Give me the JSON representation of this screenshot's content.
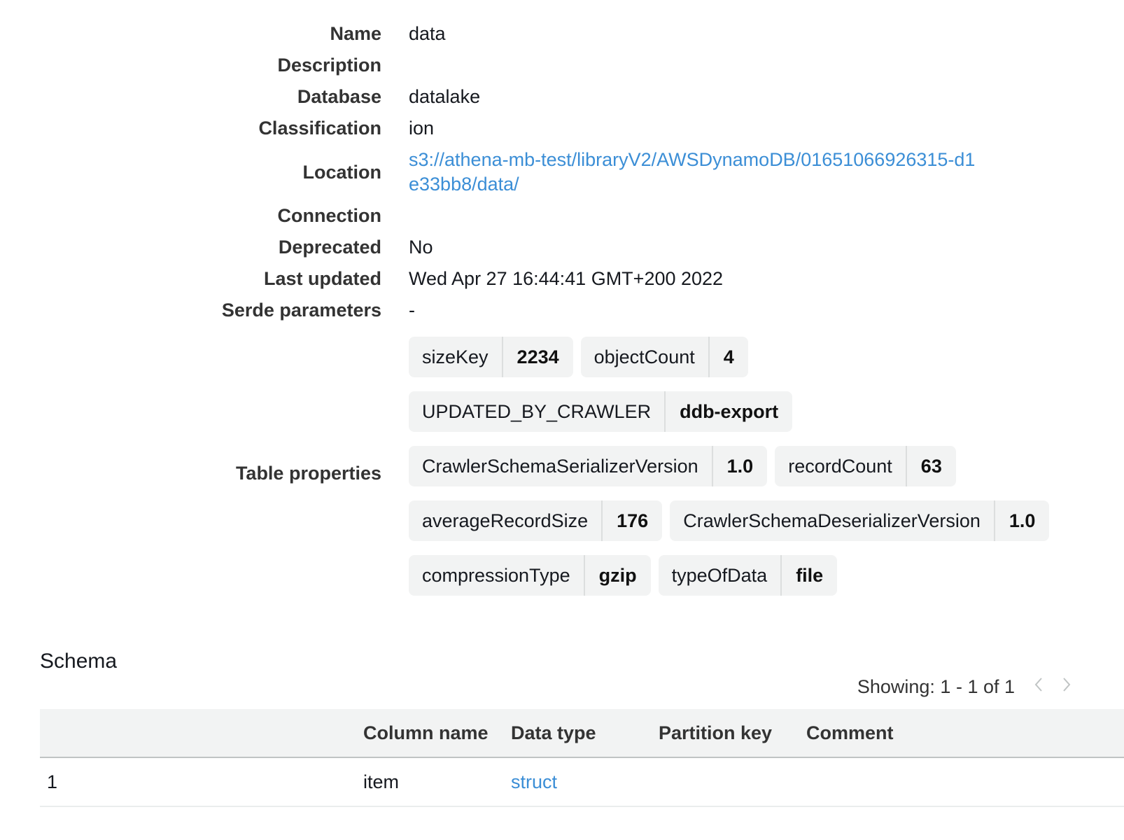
{
  "details": {
    "name": {
      "label": "Name",
      "value": "data"
    },
    "description": {
      "label": "Description",
      "value": ""
    },
    "database": {
      "label": "Database",
      "value": "datalake"
    },
    "classification": {
      "label": "Classification",
      "value": "ion"
    },
    "location": {
      "label": "Location",
      "value": "s3://athena-mb-test/libraryV2/AWSDynamoDB/01651066926315-d1e33bb8/data/"
    },
    "connection": {
      "label": "Connection",
      "value": ""
    },
    "deprecated": {
      "label": "Deprecated",
      "value": "No"
    },
    "last_updated": {
      "label": "Last updated",
      "value": "Wed Apr 27 16:44:41 GMT+200 2022"
    },
    "serde_parameters": {
      "label": "Serde parameters",
      "value": "-"
    },
    "table_properties": {
      "label": "Table properties",
      "items": [
        {
          "key": "sizeKey",
          "value": "2234"
        },
        {
          "key": "objectCount",
          "value": "4"
        },
        {
          "key": "UPDATED_BY_CRAWLER",
          "value": "ddb-export"
        },
        {
          "key": "CrawlerSchemaSerializerVersion",
          "value": "1.0"
        },
        {
          "key": "recordCount",
          "value": "63"
        },
        {
          "key": "averageRecordSize",
          "value": "176"
        },
        {
          "key": "CrawlerSchemaDeserializerVersion",
          "value": "1.0"
        },
        {
          "key": "compressionType",
          "value": "gzip"
        },
        {
          "key": "typeOfData",
          "value": "file"
        }
      ]
    }
  },
  "schema": {
    "title": "Schema",
    "pagination": {
      "text": "Showing: 1 - 1 of 1",
      "prev_icon": "chevron-left-icon",
      "next_icon": "chevron-right-icon"
    },
    "columns": [
      "",
      "Column name",
      "Data type",
      "Partition key",
      "Comment"
    ],
    "rows": [
      {
        "index": "1",
        "column_name": "item",
        "data_type": "struct",
        "partition_key": "",
        "comment": ""
      }
    ]
  },
  "colors": {
    "link": "#3b8ed6",
    "tag_background": "#f2f3f3",
    "header_background": "#f2f3f3"
  }
}
